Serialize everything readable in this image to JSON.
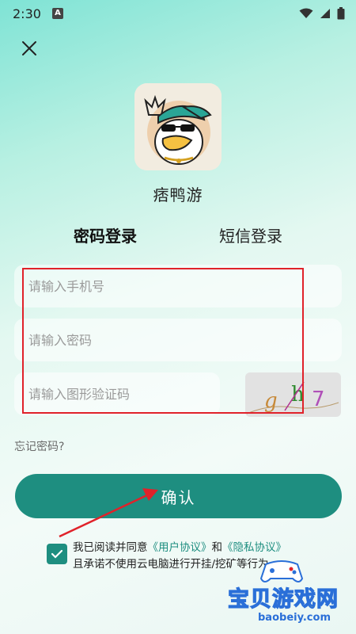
{
  "status_bar": {
    "time": "2:30",
    "notif_letter": "A"
  },
  "app": {
    "name": "痞鸭游"
  },
  "tabs": [
    {
      "label": "密码登录",
      "active": true
    },
    {
      "label": "短信登录",
      "active": false
    }
  ],
  "form": {
    "phone_placeholder": "请输入手机号",
    "password_placeholder": "请输入密码",
    "captcha_placeholder": "请输入图形验证码",
    "captcha_chars": [
      "g",
      "h",
      "7"
    ]
  },
  "forgot_label": "忘记密码?",
  "confirm_label": "确认",
  "agreement": {
    "checked": true,
    "prefix": "我已阅读并同意",
    "user_agreement": "《用户协议》",
    "and": "和",
    "privacy_agreement": "《隐私协议》",
    "suffix": "且承诺不使用云电脑进行开挂/挖矿等行为"
  },
  "watermark": {
    "text": "宝贝游戏网",
    "url": "baobeiy.com"
  },
  "colors": {
    "accent": "#1e8e80",
    "highlight": "#e0222a",
    "watermark_fill": "#ffd42a",
    "watermark_stroke": "#2a6fd8"
  }
}
